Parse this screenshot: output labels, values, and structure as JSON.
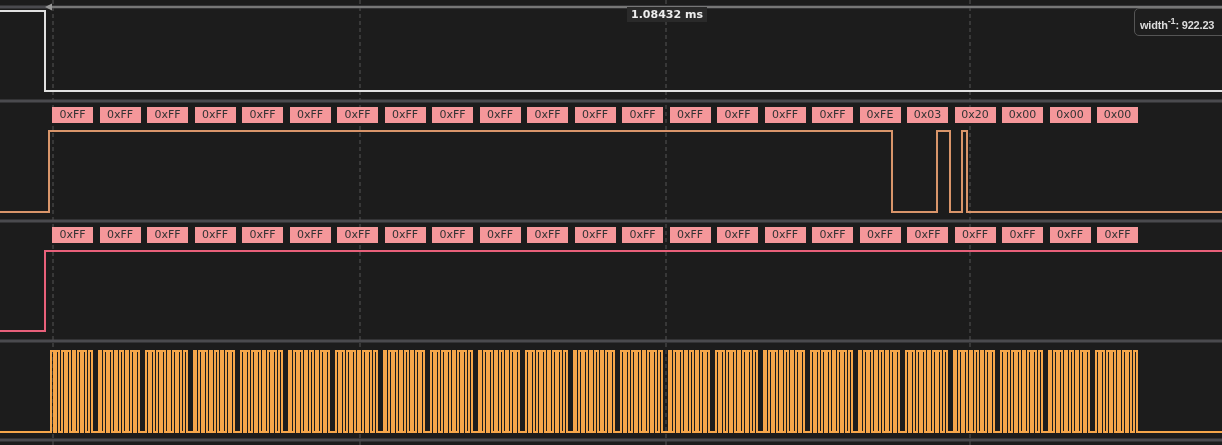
{
  "measurement": {
    "duration": "1.08432 ms",
    "tooltip": "width$^{-1}$: 922.23"
  },
  "channels": [
    {
      "color": "#e0e0e0"
    },
    {
      "color": "#d9956a",
      "decoded": [
        "0xFF",
        "0xFF",
        "0xFF",
        "0xFF",
        "0xFF",
        "0xFF",
        "0xFF",
        "0xFF",
        "0xFF",
        "0xFF",
        "0xFF",
        "0xFF",
        "0xFF",
        "0xFF",
        "0xFF",
        "0xFF",
        "0xFF",
        "0xFE",
        "0x03",
        "0x20",
        "0x00",
        "0x00",
        "0x00"
      ]
    },
    {
      "color": "#e8607a",
      "decoded": [
        "0xFF",
        "0xFF",
        "0xFF",
        "0xFF",
        "0xFF",
        "0xFF",
        "0xFF",
        "0xFF",
        "0xFF",
        "0xFF",
        "0xFF",
        "0xFF",
        "0xFF",
        "0xFF",
        "0xFF",
        "0xFF",
        "0xFF",
        "0xFF",
        "0xFF",
        "0xFF",
        "0xFF",
        "0xFF",
        "0xFF"
      ]
    },
    {
      "color": "#f5a64a"
    }
  ]
}
